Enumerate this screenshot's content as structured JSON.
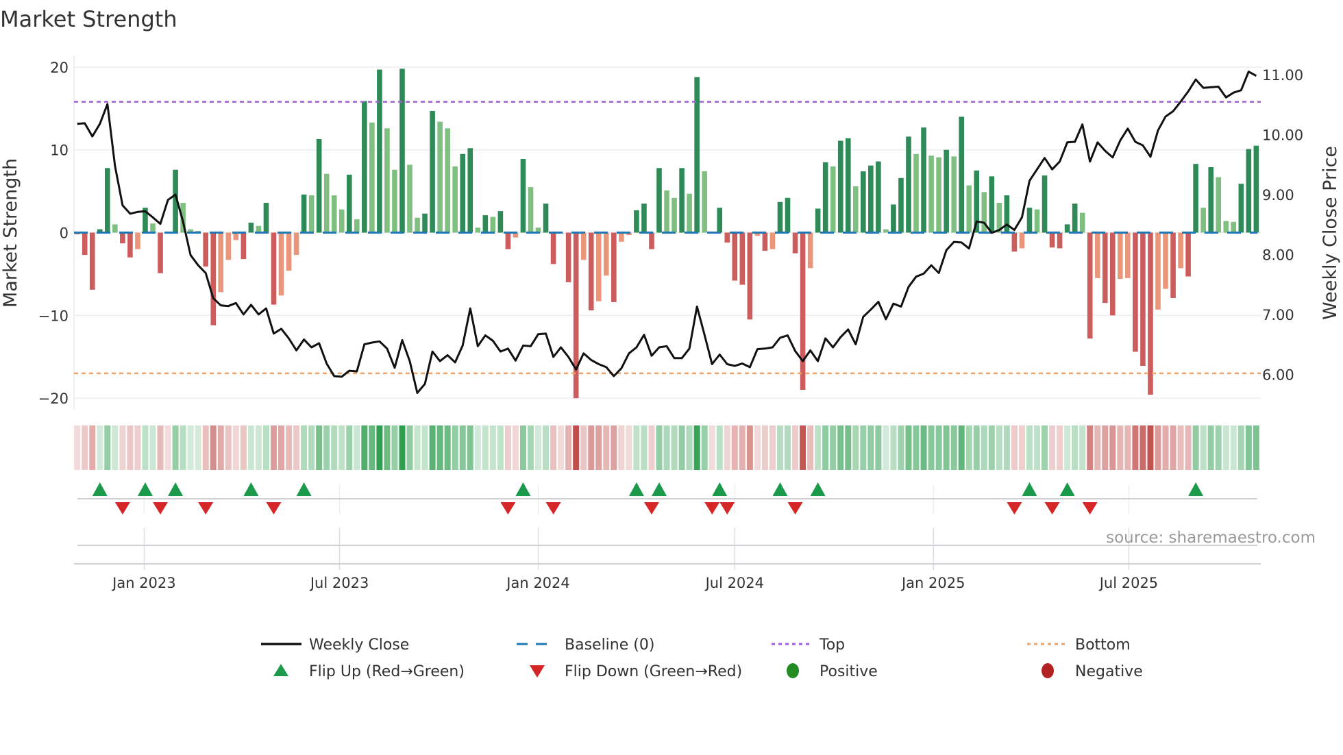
{
  "title": "Market Strength",
  "source": "source: sharemaestro.com",
  "colors": {
    "bar_pos_strong": "#2e8b57",
    "bar_pos_weak": "#7fbf7f",
    "bar_neg_strong": "#cd5c5c",
    "bar_neg_weak": "#e9967a",
    "heat_pos": "#2e9e4f",
    "heat_neg": "#c0504d",
    "price_line": "#111111",
    "baseline": "#1f77b4",
    "top_line": "#9c5fd6",
    "bottom_line": "#f0a060",
    "flip_up": "#1a9a4a",
    "flip_down": "#d62728",
    "positive": "#228b22",
    "negative": "#b22222"
  },
  "chart_data": {
    "type": "bar",
    "title": "Market Strength",
    "frequency": "weekly",
    "start_date": "2022-10-31",
    "ylabel": "Market Strength",
    "y2label": "Weekly Close Price",
    "ylim": [
      -21.4,
      21.4
    ],
    "y2lim": [
      5.41,
      11.32
    ],
    "yticks": [
      20,
      10,
      0,
      -10,
      -20
    ],
    "yticks_labels": [
      "20",
      "10",
      "0",
      "−10",
      "−20"
    ],
    "y2ticks": [
      11,
      10,
      9,
      8,
      7,
      6
    ],
    "y2ticks_labels": [
      "11.00",
      "10.00",
      "9.00",
      "8.00",
      "7.00",
      "6.00"
    ],
    "xticks": [
      {
        "date": "2023-01-01",
        "label": "Jan 2023"
      },
      {
        "date": "2023-07-01",
        "label": "Jul 2023"
      },
      {
        "date": "2024-01-01",
        "label": "Jan 2024"
      },
      {
        "date": "2024-07-01",
        "label": "Jul 2024"
      },
      {
        "date": "2025-01-01",
        "label": "Jan 2025"
      },
      {
        "date": "2025-07-01",
        "label": "Jul 2025"
      }
    ],
    "top_level": 15.8,
    "bottom_level": -17.0,
    "baseline": 0,
    "grid": true,
    "legend_position": "bottom",
    "strength": [
      -0.2,
      -2.7,
      -6.9,
      0.4,
      7.8,
      1.0,
      -1.3,
      -3.0,
      -2.0,
      3.0,
      1.1,
      -4.9,
      -0.1,
      7.6,
      3.6,
      0.4,
      0.2,
      -4.1,
      -11.2,
      -7.2,
      -3.3,
      -0.9,
      -3.2,
      1.2,
      0.8,
      3.6,
      -8.7,
      -7.6,
      -4.6,
      -2.7,
      4.6,
      4.5,
      11.3,
      7.1,
      4.5,
      2.8,
      7.0,
      1.6,
      15.9,
      13.3,
      19.7,
      12.6,
      7.6,
      19.8,
      8.2,
      1.8,
      2.3,
      14.7,
      13.4,
      12.6,
      8.0,
      9.5,
      10.2,
      0.6,
      2.1,
      1.9,
      2.6,
      -2.0,
      -0.6,
      8.9,
      5.5,
      0.6,
      3.5,
      -3.8,
      -0.1,
      -6.0,
      -20.0,
      -3.3,
      -9.4,
      -8.3,
      -5.2,
      -8.4,
      -1.1,
      -0.3,
      2.7,
      3.5,
      -2.0,
      7.8,
      5.1,
      4.2,
      7.8,
      4.7,
      18.8,
      7.4,
      -0.1,
      3.0,
      -1.2,
      -5.8,
      -6.3,
      -10.5,
      -0.4,
      -2.2,
      -2.0,
      3.7,
      4.2,
      -2.5,
      -19.0,
      -4.3,
      2.9,
      8.5,
      8.0,
      11.1,
      11.4,
      5.6,
      7.4,
      8.1,
      8.6,
      0.4,
      3.4,
      6.6,
      11.6,
      9.5,
      12.7,
      9.3,
      9.1,
      10.0,
      9.2,
      14.0,
      5.7,
      7.5,
      4.9,
      6.8,
      3.6,
      4.5,
      -2.3,
      -1.9,
      3.0,
      2.8,
      6.9,
      -1.8,
      -1.9,
      1.0,
      3.5,
      2.4,
      -12.8,
      -5.5,
      -8.5,
      -10.0,
      -5.6,
      -5.5,
      -14.4,
      -16.1,
      -19.6,
      -9.3,
      -6.8,
      -7.9,
      -4.3,
      -5.3,
      8.3,
      3.0,
      7.9,
      6.7,
      1.4,
      1.3,
      5.9,
      10.1,
      10.5
    ],
    "weekly_close": [
      10.18,
      10.19,
      9.97,
      10.18,
      10.51,
      9.48,
      8.82,
      8.68,
      8.71,
      8.72,
      8.62,
      8.51,
      8.91,
      9.0,
      8.55,
      7.99,
      7.82,
      7.69,
      7.27,
      7.15,
      7.14,
      7.19,
      7.0,
      7.16,
      7.0,
      7.1,
      6.68,
      6.76,
      6.6,
      6.4,
      6.58,
      6.45,
      6.52,
      6.18,
      5.97,
      5.96,
      6.06,
      6.05,
      6.5,
      6.53,
      6.55,
      6.43,
      6.11,
      6.57,
      6.22,
      5.69,
      5.84,
      6.38,
      6.22,
      6.32,
      6.2,
      6.48,
      7.1,
      6.47,
      6.65,
      6.56,
      6.38,
      6.43,
      6.23,
      6.48,
      6.47,
      6.67,
      6.68,
      6.29,
      6.45,
      6.29,
      6.08,
      6.35,
      6.24,
      6.17,
      6.12,
      5.97,
      6.1,
      6.35,
      6.45,
      6.66,
      6.31,
      6.45,
      6.47,
      6.27,
      6.27,
      6.43,
      7.13,
      6.66,
      6.17,
      6.33,
      6.17,
      6.14,
      6.18,
      6.12,
      6.42,
      6.43,
      6.45,
      6.61,
      6.65,
      6.39,
      6.22,
      6.4,
      6.22,
      6.6,
      6.45,
      6.62,
      6.75,
      6.5,
      6.96,
      7.08,
      7.21,
      6.92,
      7.18,
      7.13,
      7.46,
      7.63,
      7.68,
      7.82,
      7.69,
      8.07,
      8.21,
      8.2,
      8.1,
      8.55,
      8.53,
      8.36,
      8.41,
      8.5,
      8.41,
      8.62,
      9.23,
      9.42,
      9.61,
      9.42,
      9.55,
      9.87,
      9.88,
      10.17,
      9.55,
      9.87,
      9.73,
      9.62,
      9.9,
      10.1,
      9.88,
      9.82,
      9.63,
      10.07,
      10.3,
      10.39,
      10.55,
      10.72,
      10.92,
      10.78,
      10.79,
      10.8,
      10.62,
      10.7,
      10.74,
      11.05,
      10.98
    ],
    "flips": "computed where strength changes sign"
  },
  "legend": {
    "items": [
      {
        "label": "Weekly Close",
        "icon": "solid-line-icon"
      },
      {
        "label": "Baseline (0)",
        "icon": "dashed-line-icon"
      },
      {
        "label": "Top",
        "icon": "dotted-line-icon"
      },
      {
        "label": "Bottom",
        "icon": "dotted-line-icon"
      },
      {
        "label": "Flip Up (Red→Green)",
        "icon": "triangle-up-icon"
      },
      {
        "label": "Flip Down (Green→Red)",
        "icon": "triangle-down-icon"
      },
      {
        "label": "Positive",
        "icon": "circle-icon"
      },
      {
        "label": "Negative",
        "icon": "circle-icon"
      }
    ]
  }
}
